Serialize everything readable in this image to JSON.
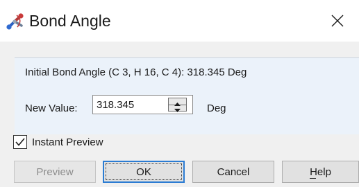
{
  "window": {
    "title": "Bond Angle",
    "icon": "molecule-app-icon",
    "close_icon": "close-icon"
  },
  "info": {
    "initial_text": "Initial Bond Angle (C 3, H 16, C 4): 318.345 Deg"
  },
  "new_value": {
    "label": "New Value:",
    "value": "318.345",
    "unit": "Deg"
  },
  "instant_preview": {
    "label": "Instant Preview",
    "checked": true
  },
  "buttons": {
    "preview": "Preview",
    "ok": "OK",
    "cancel": "Cancel",
    "help": "Help"
  },
  "colors": {
    "dialog_bg": "#f0f0f0",
    "group_bg": "#ebf2fa",
    "default_button_border": "#2b7cd3"
  }
}
